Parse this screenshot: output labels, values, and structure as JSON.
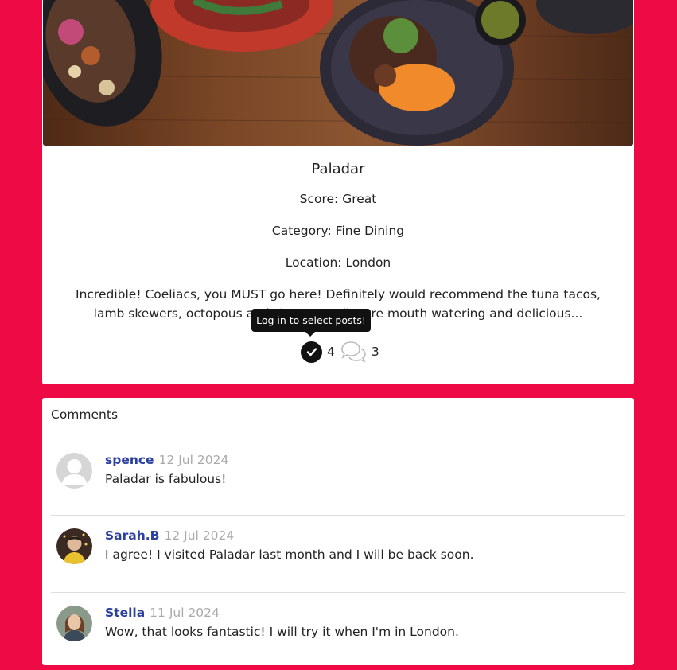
{
  "post": {
    "title": "Paladar",
    "score": "Score: Great",
    "category": "Category: Fine Dining",
    "location": "Location: London",
    "excerpt": "Incredible! Coeliacs, you MUST go here! Definitely would recommend the tuna tacos, lamb skewers, octopous and churros... all were mouth watering and delicious...",
    "select_count": "4",
    "comment_count": "3",
    "tooltip": "Log in to select posts!"
  },
  "icons": {
    "select": "check-circle-icon",
    "comments": "comments-icon"
  },
  "comments": {
    "header": "Comments",
    "items": [
      {
        "author": "spence",
        "date": "12 Jul 2024",
        "body": "Paladar is fabulous!",
        "avatar": "default-avatar"
      },
      {
        "author": "Sarah.B",
        "date": "12 Jul 2024",
        "body": "I agree! I visited Paladar last month and I will be back soon.",
        "avatar": "photo-avatar"
      },
      {
        "author": "Stella",
        "date": "11 Jul 2024",
        "body": "Wow, that looks fantastic! I will try it when I'm in London.",
        "avatar": "photo-avatar"
      }
    ]
  },
  "colors": {
    "background": "#ee0b45",
    "author_link": "#2a3fa0"
  }
}
